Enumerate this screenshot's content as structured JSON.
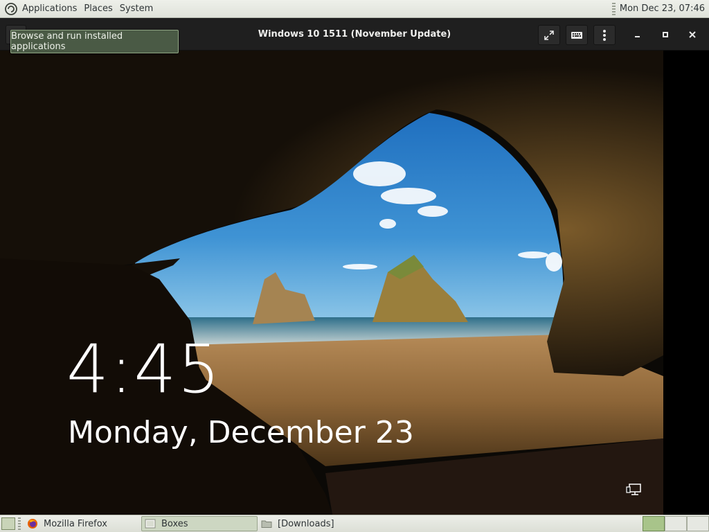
{
  "top_panel": {
    "menus": [
      "Applications",
      "Places",
      "System"
    ],
    "clock": "Mon Dec 23, 07:46"
  },
  "tooltip": "Browse and run installed applications",
  "header": {
    "title": "Windows 10 1511 (November Update)"
  },
  "lockscreen": {
    "time": "4:45",
    "date": "Monday, December 23"
  },
  "taskbar": {
    "tasks": [
      {
        "label": "Mozilla Firefox",
        "icon": "firefox-icon",
        "active": false
      },
      {
        "label": "Boxes",
        "icon": "boxes-icon",
        "active": true
      },
      {
        "label": "[Downloads]",
        "icon": "folder-icon",
        "active": false
      }
    ]
  },
  "colors": {
    "panel_bg": "#e4e7df",
    "header_bg": "#1f1f1f",
    "tooltip_bg": "#4a5a45",
    "active_workspace": "#a8c48a"
  }
}
